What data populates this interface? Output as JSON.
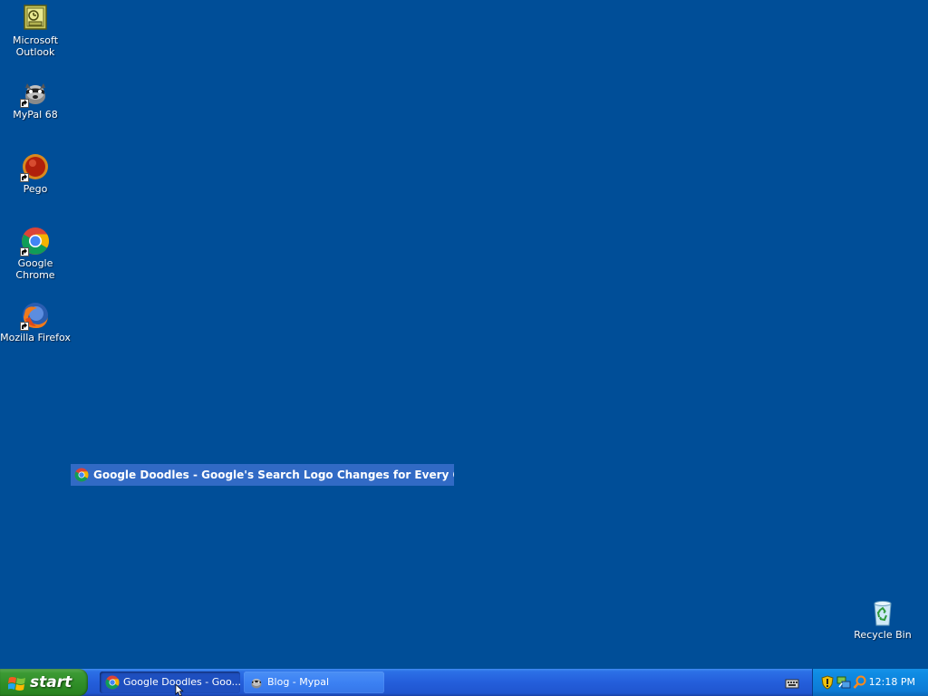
{
  "desktop": {
    "background_color": "#004e98",
    "icons": [
      {
        "label": "Microsoft Outlook",
        "icon": "outlook-icon",
        "shortcut": false
      },
      {
        "label": "MyPal 68",
        "icon": "mypal-icon",
        "shortcut": true
      },
      {
        "label": "Pego",
        "icon": "pego-icon",
        "shortcut": true
      },
      {
        "label": "Google Chrome",
        "icon": "chrome-icon",
        "shortcut": true
      },
      {
        "label": "Mozilla Firefox",
        "icon": "firefox-icon",
        "shortcut": true
      }
    ],
    "recycle_bin": {
      "label": "Recycle Bin",
      "icon": "recycle-bin-icon"
    }
  },
  "drag_label": {
    "text": "Google Doodles - Google's Search Logo Changes for Every Occasion",
    "icon": "chrome-icon",
    "highlight_color": "#316ac5"
  },
  "taskbar": {
    "start_label": "start",
    "tasks": [
      {
        "label": "Google Doodles - Goo...",
        "icon": "chrome-icon",
        "active": true
      },
      {
        "label": "Blog - Mypal",
        "icon": "mypal-icon",
        "active": false
      }
    ],
    "tray_icons": [
      "keyboard-icon",
      "security-shield-icon",
      "network-icon",
      "search-icon"
    ],
    "clock": "12:18 PM"
  }
}
